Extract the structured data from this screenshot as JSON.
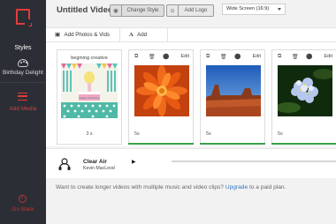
{
  "app": {
    "title": "Untitled Video"
  },
  "header": {
    "change_style": "Change Style",
    "add_logo": "Add Logo",
    "aspect_ratio": "Wide Screen (16:9)"
  },
  "toolbar": {
    "add_photos": "Add Photos & Vids",
    "add_text": "Add Text"
  },
  "sidebar": {
    "section": "Styles",
    "theme": "Birthday Delight",
    "add_media": "Add Media",
    "go_back": "Go Back"
  },
  "cards": [
    {
      "caption": "begining creative",
      "duration": "3 s",
      "kind": "intro",
      "edit": ""
    },
    {
      "edit": "Edit",
      "duration": "5s",
      "kind": "image",
      "subject": "orange flower"
    },
    {
      "edit": "Edit",
      "duration": "5s",
      "kind": "image",
      "subject": "desert butte"
    },
    {
      "edit": "Edit",
      "duration": "5s",
      "kind": "image",
      "subject": "hydrangea"
    }
  ],
  "audio": {
    "track": "Clear Air",
    "artist": "Kevin MacLeod",
    "progress": 0.0
  },
  "upgrade": {
    "prefix": "Want to create longer videos with multiple music and video clips?",
    "link": "Upgrade",
    "suffix": "to a paid plan."
  },
  "colors": {
    "accent": "#e23b3b",
    "sidebar": "#2b2e34",
    "link": "#2a79c4",
    "active_line": "#3aa14a"
  },
  "icons": {
    "logo": "brand-logo-icon",
    "styles": "palette-icon",
    "media": "menu-icon",
    "back": "back-icon",
    "photos": "photo-icon",
    "text": "text-icon",
    "audio": "headphones-icon"
  }
}
